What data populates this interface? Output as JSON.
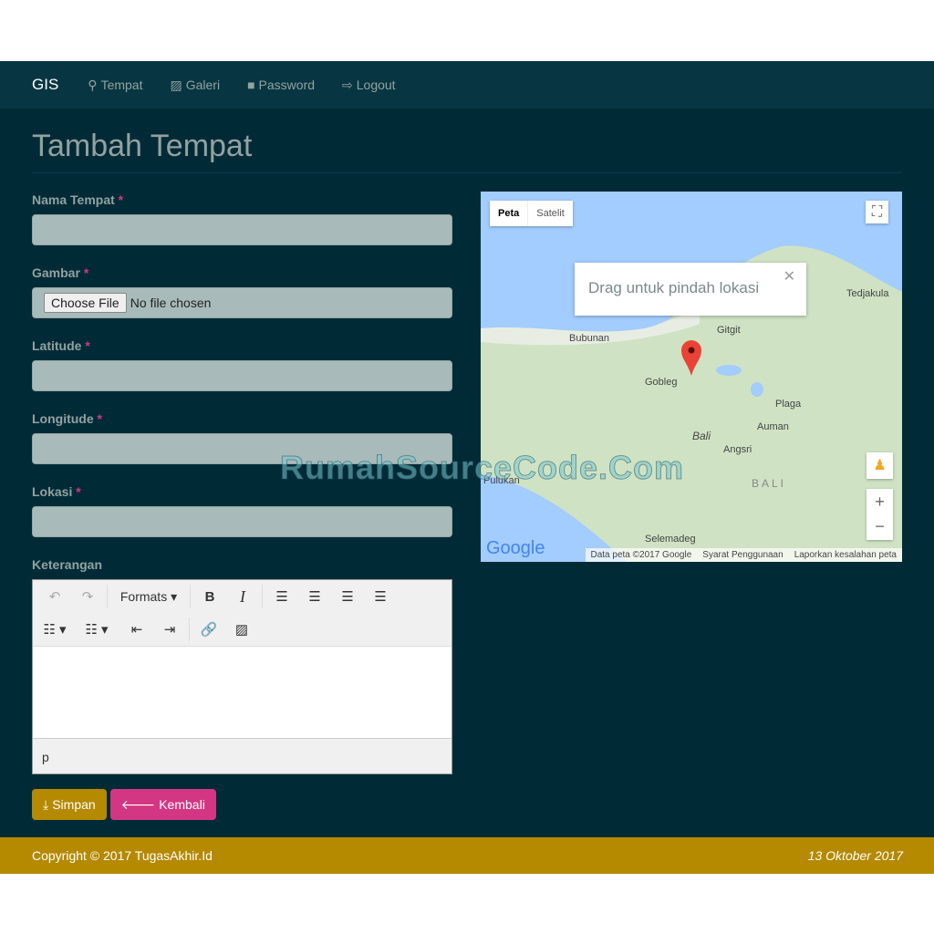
{
  "nav": {
    "brand": "GIS",
    "items": [
      {
        "label": "Tempat",
        "icon": "map-marker-icon"
      },
      {
        "label": "Galeri",
        "icon": "picture-icon"
      },
      {
        "label": "Password",
        "icon": "lock-icon"
      },
      {
        "label": "Logout",
        "icon": "logout-icon"
      }
    ]
  },
  "page": {
    "title": "Tambah Tempat"
  },
  "form": {
    "nama_label": "Nama Tempat",
    "gambar_label": "Gambar",
    "file_button": "Choose File",
    "file_status": "No file chosen",
    "latitude_label": "Latitude",
    "longitude_label": "Longitude",
    "lokasi_label": "Lokasi",
    "keterangan_label": "Keterangan",
    "required_mark": "*",
    "editor": {
      "formats": "Formats",
      "status_path": "p"
    },
    "simpan": "Simpan",
    "kembali": "Kembali"
  },
  "map": {
    "type_peta": "Peta",
    "type_satelit": "Satelit",
    "popup": "Drag untuk pindah lokasi",
    "places": [
      "Tedjakula",
      "Bubunan",
      "Gitgit",
      "Gobleg",
      "Plaga",
      "Auman",
      "Bali",
      "Angsri",
      "BALI",
      "Pulukan",
      "Selemadeg"
    ],
    "logo": "Google",
    "attribution": [
      "Data peta ©2017 Google",
      "Syarat Penggunaan",
      "Laporkan kesalahan peta"
    ]
  },
  "watermark": "RumahSourceCode.Com",
  "footer": {
    "copyright": "Copyright © 2017 TugasAkhir.Id",
    "date": "13 Oktober 2017"
  },
  "colors": {
    "navbar": "#073642",
    "body": "#002b36",
    "footer": "#b58900",
    "simpan": "#b58900",
    "kembali": "#d33682"
  }
}
